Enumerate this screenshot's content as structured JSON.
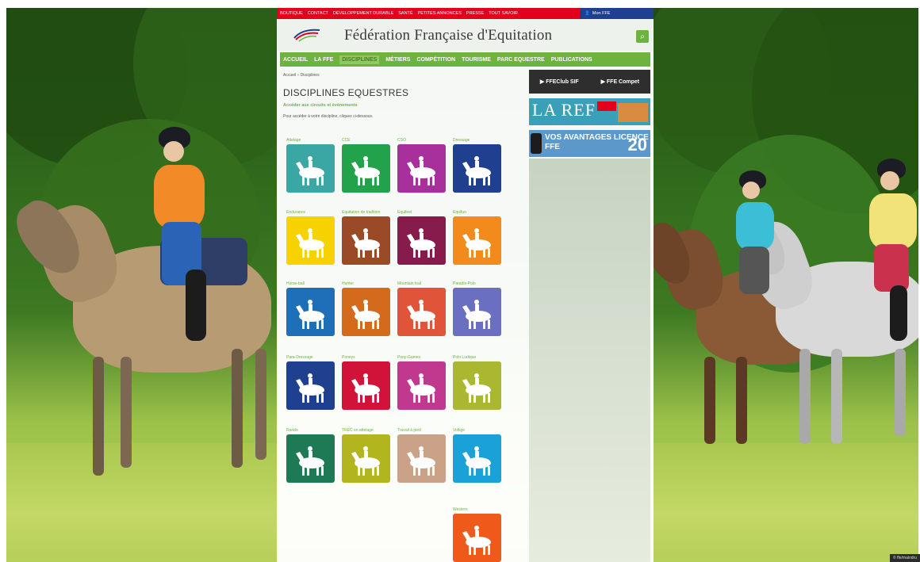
{
  "topbar": {
    "links": [
      "Boutique",
      "Contact",
      "Développement durable",
      "Santé",
      "Petites annonces",
      "Presse",
      "Tout savoir"
    ],
    "user_label": "Mon FFE"
  },
  "header": {
    "site_title": "Fédération Française d'Equitation"
  },
  "nav": {
    "items": [
      "Accueil",
      "La FFE",
      "Disciplines",
      "Métiers",
      "Compétition",
      "Tourisme",
      "Parc Equestre",
      "Publications"
    ],
    "active": "Disciplines"
  },
  "breadcrumb": {
    "home": "Accueil",
    "current": "Disciplines"
  },
  "content": {
    "title": "DISCIPLINES EQUESTRES",
    "lead": "Accéder aux circuits et évènements",
    "hint": "Pour accéder à votre discipline, cliquez ci-dessous."
  },
  "disciplines": [
    {
      "label": "Attelage",
      "color": "#3aa7a5"
    },
    {
      "label": "CCE",
      "color": "#22a24a"
    },
    {
      "label": "CSO",
      "color": "#a8309c"
    },
    {
      "label": "Dressage",
      "color": "#1f3f8f"
    },
    {
      "label": "Endurance",
      "color": "#f5d200"
    },
    {
      "label": "Equitation de tradition",
      "color": "#9a4a26"
    },
    {
      "label": "Equifeel",
      "color": "#861b4c"
    },
    {
      "label": "Equifun",
      "color": "#f28a1c"
    },
    {
      "label": "Horse-ball",
      "color": "#1f6fb8"
    },
    {
      "label": "Hunter",
      "color": "#d46a1c"
    },
    {
      "label": "Mountain trail",
      "color": "#e0553a"
    },
    {
      "label": "Paradis-Polo",
      "color": "#6a6fc2"
    },
    {
      "label": "Para-Dressage",
      "color": "#1f3f8f"
    },
    {
      "label": "Poneys",
      "color": "#d1133a"
    },
    {
      "label": "Pony-Games",
      "color": "#c0398e"
    },
    {
      "label": "Polo Ludique",
      "color": "#a9b830"
    },
    {
      "label": "Rando",
      "color": "#1e7a55"
    },
    {
      "label": "TREC en attelage",
      "color": "#b3b51f"
    },
    {
      "label": "Travail à pied",
      "color": "#caa287"
    },
    {
      "label": "Voltige",
      "color": "#1aa2d8"
    },
    {
      "label": "Western",
      "color": "#ef5a1a"
    }
  ],
  "sidebar": {
    "ffeclub": "▶ FFEClub SIF",
    "ffecompet": "▶ FFE Compet",
    "laref": "LA REF",
    "advantages": "Vos avantages licence FFE",
    "advantages_num": "20"
  },
  "credit": "© ffe/maindru",
  "colors": {
    "accent_green": "#6cb33f",
    "topbar_red": "#e2001a",
    "topbar_blue": "#1f3f8f"
  }
}
